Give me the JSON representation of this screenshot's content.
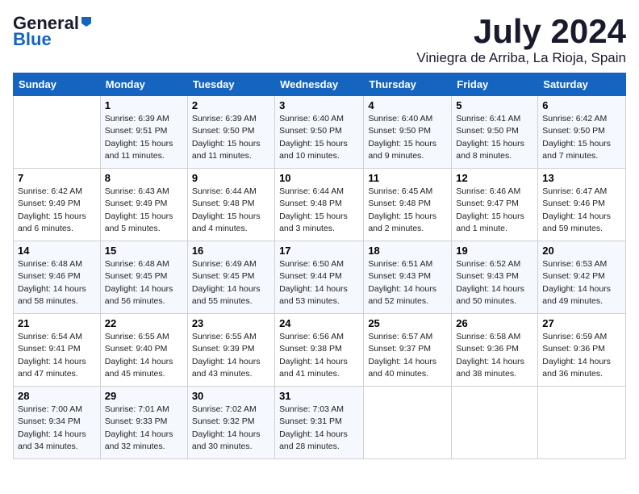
{
  "header": {
    "logo_general": "General",
    "logo_blue": "Blue",
    "title": "July 2024",
    "location": "Viniegra de Arriba, La Rioja, Spain"
  },
  "weekdays": [
    "Sunday",
    "Monday",
    "Tuesday",
    "Wednesday",
    "Thursday",
    "Friday",
    "Saturday"
  ],
  "weeks": [
    [
      {
        "day": "",
        "sunrise": "",
        "sunset": "",
        "daylight": ""
      },
      {
        "day": "1",
        "sunrise": "Sunrise: 6:39 AM",
        "sunset": "Sunset: 9:51 PM",
        "daylight": "Daylight: 15 hours and 11 minutes."
      },
      {
        "day": "2",
        "sunrise": "Sunrise: 6:39 AM",
        "sunset": "Sunset: 9:50 PM",
        "daylight": "Daylight: 15 hours and 11 minutes."
      },
      {
        "day": "3",
        "sunrise": "Sunrise: 6:40 AM",
        "sunset": "Sunset: 9:50 PM",
        "daylight": "Daylight: 15 hours and 10 minutes."
      },
      {
        "day": "4",
        "sunrise": "Sunrise: 6:40 AM",
        "sunset": "Sunset: 9:50 PM",
        "daylight": "Daylight: 15 hours and 9 minutes."
      },
      {
        "day": "5",
        "sunrise": "Sunrise: 6:41 AM",
        "sunset": "Sunset: 9:50 PM",
        "daylight": "Daylight: 15 hours and 8 minutes."
      },
      {
        "day": "6",
        "sunrise": "Sunrise: 6:42 AM",
        "sunset": "Sunset: 9:50 PM",
        "daylight": "Daylight: 15 hours and 7 minutes."
      }
    ],
    [
      {
        "day": "7",
        "sunrise": "Sunrise: 6:42 AM",
        "sunset": "Sunset: 9:49 PM",
        "daylight": "Daylight: 15 hours and 6 minutes."
      },
      {
        "day": "8",
        "sunrise": "Sunrise: 6:43 AM",
        "sunset": "Sunset: 9:49 PM",
        "daylight": "Daylight: 15 hours and 5 minutes."
      },
      {
        "day": "9",
        "sunrise": "Sunrise: 6:44 AM",
        "sunset": "Sunset: 9:48 PM",
        "daylight": "Daylight: 15 hours and 4 minutes."
      },
      {
        "day": "10",
        "sunrise": "Sunrise: 6:44 AM",
        "sunset": "Sunset: 9:48 PM",
        "daylight": "Daylight: 15 hours and 3 minutes."
      },
      {
        "day": "11",
        "sunrise": "Sunrise: 6:45 AM",
        "sunset": "Sunset: 9:48 PM",
        "daylight": "Daylight: 15 hours and 2 minutes."
      },
      {
        "day": "12",
        "sunrise": "Sunrise: 6:46 AM",
        "sunset": "Sunset: 9:47 PM",
        "daylight": "Daylight: 15 hours and 1 minute."
      },
      {
        "day": "13",
        "sunrise": "Sunrise: 6:47 AM",
        "sunset": "Sunset: 9:46 PM",
        "daylight": "Daylight: 14 hours and 59 minutes."
      }
    ],
    [
      {
        "day": "14",
        "sunrise": "Sunrise: 6:48 AM",
        "sunset": "Sunset: 9:46 PM",
        "daylight": "Daylight: 14 hours and 58 minutes."
      },
      {
        "day": "15",
        "sunrise": "Sunrise: 6:48 AM",
        "sunset": "Sunset: 9:45 PM",
        "daylight": "Daylight: 14 hours and 56 minutes."
      },
      {
        "day": "16",
        "sunrise": "Sunrise: 6:49 AM",
        "sunset": "Sunset: 9:45 PM",
        "daylight": "Daylight: 14 hours and 55 minutes."
      },
      {
        "day": "17",
        "sunrise": "Sunrise: 6:50 AM",
        "sunset": "Sunset: 9:44 PM",
        "daylight": "Daylight: 14 hours and 53 minutes."
      },
      {
        "day": "18",
        "sunrise": "Sunrise: 6:51 AM",
        "sunset": "Sunset: 9:43 PM",
        "daylight": "Daylight: 14 hours and 52 minutes."
      },
      {
        "day": "19",
        "sunrise": "Sunrise: 6:52 AM",
        "sunset": "Sunset: 9:43 PM",
        "daylight": "Daylight: 14 hours and 50 minutes."
      },
      {
        "day": "20",
        "sunrise": "Sunrise: 6:53 AM",
        "sunset": "Sunset: 9:42 PM",
        "daylight": "Daylight: 14 hours and 49 minutes."
      }
    ],
    [
      {
        "day": "21",
        "sunrise": "Sunrise: 6:54 AM",
        "sunset": "Sunset: 9:41 PM",
        "daylight": "Daylight: 14 hours and 47 minutes."
      },
      {
        "day": "22",
        "sunrise": "Sunrise: 6:55 AM",
        "sunset": "Sunset: 9:40 PM",
        "daylight": "Daylight: 14 hours and 45 minutes."
      },
      {
        "day": "23",
        "sunrise": "Sunrise: 6:55 AM",
        "sunset": "Sunset: 9:39 PM",
        "daylight": "Daylight: 14 hours and 43 minutes."
      },
      {
        "day": "24",
        "sunrise": "Sunrise: 6:56 AM",
        "sunset": "Sunset: 9:38 PM",
        "daylight": "Daylight: 14 hours and 41 minutes."
      },
      {
        "day": "25",
        "sunrise": "Sunrise: 6:57 AM",
        "sunset": "Sunset: 9:37 PM",
        "daylight": "Daylight: 14 hours and 40 minutes."
      },
      {
        "day": "26",
        "sunrise": "Sunrise: 6:58 AM",
        "sunset": "Sunset: 9:36 PM",
        "daylight": "Daylight: 14 hours and 38 minutes."
      },
      {
        "day": "27",
        "sunrise": "Sunrise: 6:59 AM",
        "sunset": "Sunset: 9:36 PM",
        "daylight": "Daylight: 14 hours and 36 minutes."
      }
    ],
    [
      {
        "day": "28",
        "sunrise": "Sunrise: 7:00 AM",
        "sunset": "Sunset: 9:34 PM",
        "daylight": "Daylight: 14 hours and 34 minutes."
      },
      {
        "day": "29",
        "sunrise": "Sunrise: 7:01 AM",
        "sunset": "Sunset: 9:33 PM",
        "daylight": "Daylight: 14 hours and 32 minutes."
      },
      {
        "day": "30",
        "sunrise": "Sunrise: 7:02 AM",
        "sunset": "Sunset: 9:32 PM",
        "daylight": "Daylight: 14 hours and 30 minutes."
      },
      {
        "day": "31",
        "sunrise": "Sunrise: 7:03 AM",
        "sunset": "Sunset: 9:31 PM",
        "daylight": "Daylight: 14 hours and 28 minutes."
      },
      {
        "day": "",
        "sunrise": "",
        "sunset": "",
        "daylight": ""
      },
      {
        "day": "",
        "sunrise": "",
        "sunset": "",
        "daylight": ""
      },
      {
        "day": "",
        "sunrise": "",
        "sunset": "",
        "daylight": ""
      }
    ]
  ]
}
